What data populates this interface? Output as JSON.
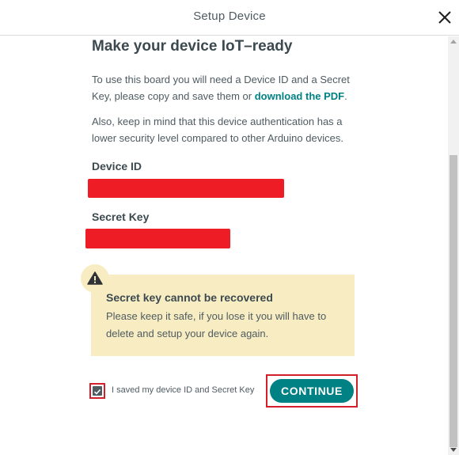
{
  "header": {
    "title": "Setup Device",
    "close_icon": "close-icon"
  },
  "main": {
    "title": "Make your device IoT–ready",
    "intro_text_before_link": "To use this board you will need a Device ID and a Secret Key, please copy and save them or ",
    "intro_link": "download the PDF",
    "intro_text_after_link": ".",
    "security_note": "Also, keep in mind that this device authentication has a lower security level compared to other Arduino devices.",
    "device_id_label": "Device ID",
    "secret_key_label": "Secret Key"
  },
  "warning": {
    "icon": "warning-icon",
    "title": "Secret key cannot be recovered",
    "text": "Please keep it safe, if you lose it you will have to delete and setup your device again."
  },
  "footer": {
    "checkbox_label": "I saved my device ID and Secret Key",
    "checkbox_checked": true,
    "continue_label": "CONTINUE"
  },
  "colors": {
    "accent": "#008184",
    "warning_bg": "#f8edc2",
    "highlight": "#d21f2a"
  }
}
